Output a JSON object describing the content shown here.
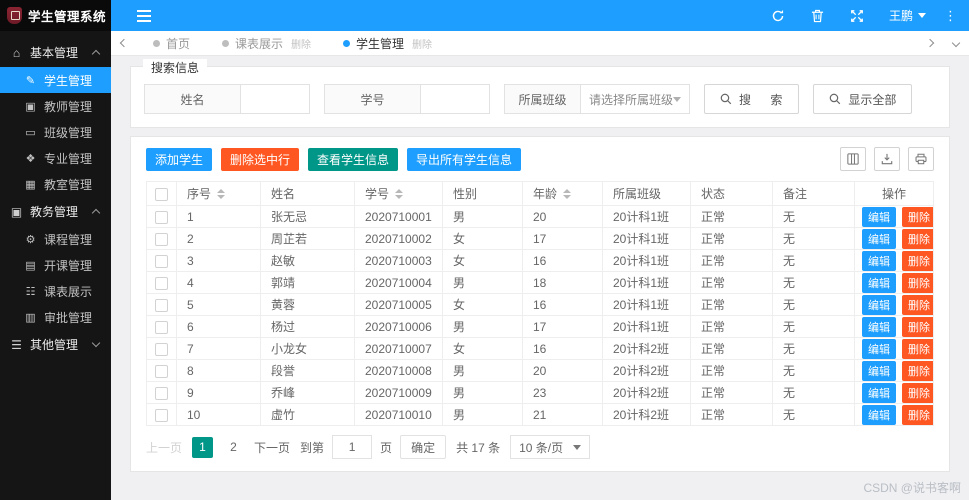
{
  "app": {
    "title": "学生管理系统",
    "watermark": "CSDN @说书客啊"
  },
  "colors": {
    "accent": "#1E9FFF",
    "danger": "#FF5722",
    "success": "#009688",
    "sidebar_bg": "#151515"
  },
  "icons": {
    "home": "⌂",
    "pencil": "✎",
    "briefcase": "▣",
    "window": "▭",
    "leaf": "❖",
    "building": "▦",
    "wrench": "⚙",
    "calendar": "▤",
    "table": "☷",
    "book": "▥",
    "list": "☰"
  },
  "header": {
    "user": "王鹏"
  },
  "sidebar": {
    "groups": [
      {
        "label": "基本管理",
        "expanded": true,
        "items": [
          {
            "label": "学生管理",
            "active": true
          },
          {
            "label": "教师管理"
          },
          {
            "label": "班级管理"
          },
          {
            "label": "专业管理"
          },
          {
            "label": "教室管理"
          }
        ]
      },
      {
        "label": "教务管理",
        "expanded": true,
        "items": [
          {
            "label": "课程管理"
          },
          {
            "label": "开课管理"
          },
          {
            "label": "课表展示"
          },
          {
            "label": "审批管理"
          }
        ]
      },
      {
        "label": "其他管理",
        "expanded": false,
        "items": []
      }
    ]
  },
  "tabs": [
    {
      "label": "首页",
      "active": false,
      "close_label": ""
    },
    {
      "label": "课表展示",
      "active": false,
      "close_label": "删除"
    },
    {
      "label": "学生管理",
      "active": true,
      "close_label": "删除"
    }
  ],
  "search": {
    "legend": "搜索信息",
    "name_label": "姓名",
    "sid_label": "学号",
    "class_label": "所属班级",
    "class_placeholder": "请选择所属班级",
    "search_button": "搜 索",
    "show_all_button": "显示全部"
  },
  "toolbar": {
    "add": "添加学生",
    "delete_selected": "删除选中行",
    "view": "查看学生信息",
    "export": "导出所有学生信息"
  },
  "table": {
    "columns": [
      "序号",
      "姓名",
      "学号",
      "性别",
      "年龄",
      "所属班级",
      "状态",
      "备注",
      "操作"
    ],
    "edit_label": "编辑",
    "delete_label": "删除",
    "rows": [
      {
        "no": "1",
        "name": "张无忌",
        "sid": "2020710001",
        "gender": "男",
        "age": "20",
        "class": "20计科1班",
        "status": "正常",
        "remark": "无"
      },
      {
        "no": "2",
        "name": "周芷若",
        "sid": "2020710002",
        "gender": "女",
        "age": "17",
        "class": "20计科1班",
        "status": "正常",
        "remark": "无"
      },
      {
        "no": "3",
        "name": "赵敏",
        "sid": "2020710003",
        "gender": "女",
        "age": "16",
        "class": "20计科1班",
        "status": "正常",
        "remark": "无"
      },
      {
        "no": "4",
        "name": "郭靖",
        "sid": "2020710004",
        "gender": "男",
        "age": "18",
        "class": "20计科1班",
        "status": "正常",
        "remark": "无"
      },
      {
        "no": "5",
        "name": "黄蓉",
        "sid": "2020710005",
        "gender": "女",
        "age": "16",
        "class": "20计科1班",
        "status": "正常",
        "remark": "无"
      },
      {
        "no": "6",
        "name": "杨过",
        "sid": "2020710006",
        "gender": "男",
        "age": "17",
        "class": "20计科1班",
        "status": "正常",
        "remark": "无"
      },
      {
        "no": "7",
        "name": "小龙女",
        "sid": "2020710007",
        "gender": "女",
        "age": "16",
        "class": "20计科2班",
        "status": "正常",
        "remark": "无"
      },
      {
        "no": "8",
        "name": "段誉",
        "sid": "2020710008",
        "gender": "男",
        "age": "20",
        "class": "20计科2班",
        "status": "正常",
        "remark": "无"
      },
      {
        "no": "9",
        "name": "乔峰",
        "sid": "2020710009",
        "gender": "男",
        "age": "23",
        "class": "20计科2班",
        "status": "正常",
        "remark": "无"
      },
      {
        "no": "10",
        "name": "虚竹",
        "sid": "2020710010",
        "gender": "男",
        "age": "21",
        "class": "20计科2班",
        "status": "正常",
        "remark": "无"
      }
    ]
  },
  "pagination": {
    "prev": "上一页",
    "pages": [
      "1",
      "2"
    ],
    "active_page": "1",
    "next": "下一页",
    "goto_prefix": "到第",
    "goto_value": "1",
    "goto_suffix": "页",
    "confirm": "确定",
    "total": "共 17 条",
    "page_size": "10 条/页"
  }
}
